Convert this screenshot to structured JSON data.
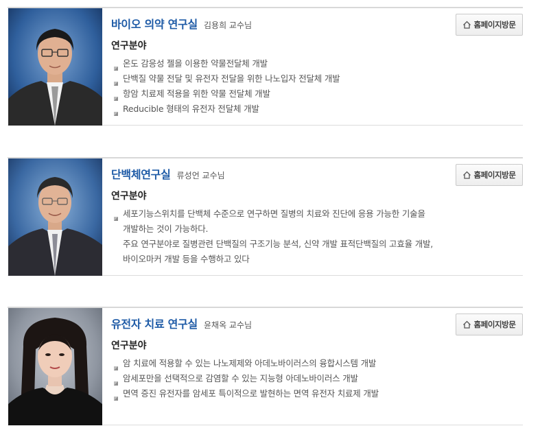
{
  "labs": [
    {
      "title": "바이오 의약 연구실",
      "professor": "김용희 교수님",
      "home_button": "홈페이지방문",
      "field_label": "연구분야",
      "items": [
        "온도 감응성 젤을 이용한 약물전달체 개발",
        "단백질 약물 전달 및 유전자 전달을 위한 나노입자 전달체 개발",
        "항암 치료제 적용을 위한 약물 전달체 개발",
        "Reducible 형태의 유전자 전달체 개발"
      ]
    },
    {
      "title": "단백체연구실",
      "professor": "류성언 교수님",
      "home_button": "홈페이지방문",
      "field_label": "연구분야",
      "paragraph_lines": [
        "세포기능스위치를 단백체 수준으로 연구하면 질병의 치료와 진단에 응용 가능한 기술을",
        "개발하는 것이 가능하다.",
        "주요 연구분야로 질병관련 단백질의 구조기능 분석, 신약 개발 표적단백질의 고효율 개발,",
        "바이오마커 개발 등을 수행하고 있다"
      ]
    },
    {
      "title": "유전자 치료 연구실",
      "professor": "윤채옥 교수님",
      "home_button": "홈페이지방문",
      "field_label": "연구분야",
      "items": [
        "암 치료에 적용할 수 있는 나노제제와 아데노바이러스의 융합시스템 개발",
        "암세포만을 선택적으로 감염할 수 있는 지능형 아데노바이러스 개발",
        "면역 증진 유전자를 암세포 특이적으로 발현하는 면역 유전자 치료제 개발"
      ]
    }
  ],
  "colors": {
    "title": "#1d5aa6",
    "text": "#555555",
    "button_bg": "#f2f2f2",
    "border": "#d8d8d8"
  },
  "icons": {
    "home_button": "home-icon",
    "bullet": "square-bullet-icon"
  }
}
